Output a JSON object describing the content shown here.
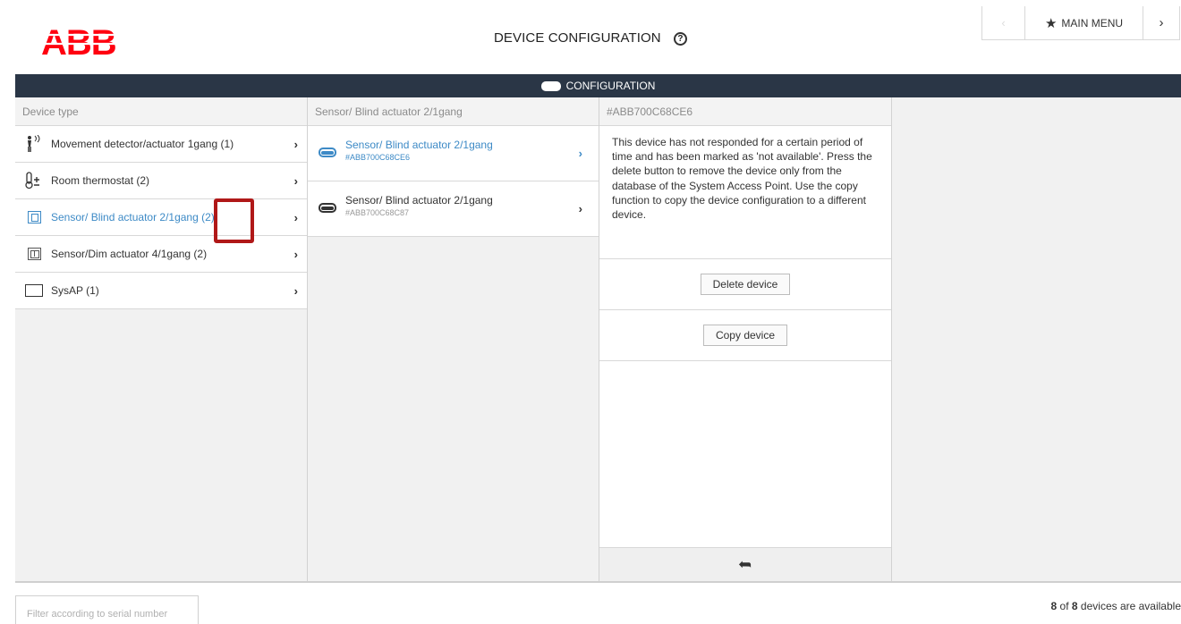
{
  "header": {
    "logo_text": "ABB",
    "page_title": "DEVICE CONFIGURATION",
    "help_glyph": "?",
    "main_menu_label": "MAIN MENU",
    "back_glyph": "‹",
    "forward_glyph": "›",
    "star_glyph": "★"
  },
  "config_bar": {
    "label": "CONFIGURATION"
  },
  "columns": {
    "device_type_header": "Device type",
    "device_list_header": "Sensor/ Blind actuator 2/1gang",
    "detail_header": "#ABB700C68CE6"
  },
  "device_types": [
    {
      "label": "Movement detector/actuator 1gang (1)",
      "icon": "motion-detector-icon"
    },
    {
      "label": "Room thermostat (2)",
      "icon": "thermostat-icon"
    },
    {
      "label": "Sensor/ Blind actuator 2/1gang (2)",
      "icon": "blind-actuator-icon"
    },
    {
      "label": "Sensor/Dim actuator 4/1gang (2)",
      "icon": "dim-actuator-icon"
    },
    {
      "label": "SysAP (1)",
      "icon": "sysap-icon"
    }
  ],
  "devices": [
    {
      "name": "Sensor/ Blind actuator 2/1gang",
      "serial": "#ABB700C68CE6"
    },
    {
      "name": "Sensor/ Blind actuator 2/1gang",
      "serial": "#ABB700C68C87"
    }
  ],
  "detail": {
    "message": "This device has not responded for a certain period of time and has been marked as 'not available'. Press the delete button to remove the device only from the database of the System Access Point. Use the copy function to copy the device configuration to a different device.",
    "delete_label": "Delete device",
    "copy_label": "Copy device",
    "back_glyph": "➦"
  },
  "footer": {
    "filter_placeholder": "Filter according to serial number",
    "count_shown": "8",
    "count_of": " of ",
    "count_total": "8",
    "count_suffix": " devices are available"
  },
  "colors": {
    "accent": "#3d8ac6",
    "bar": "#2a3646",
    "logo": "#ff000f",
    "highlight": "#b01818"
  }
}
